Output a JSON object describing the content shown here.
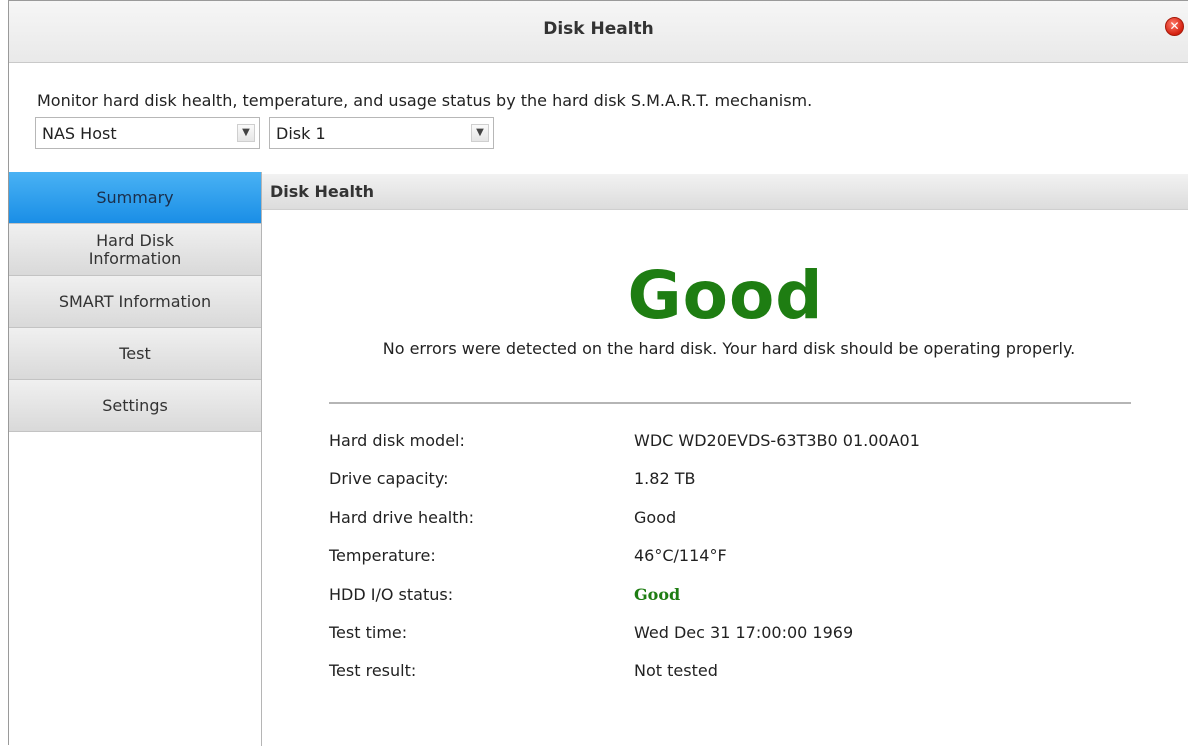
{
  "window": {
    "title": "Disk Health"
  },
  "description": "Monitor hard disk health, temperature, and usage status by the hard disk S.M.A.R.T. mechanism.",
  "selectors": {
    "host": "NAS Host",
    "disk": "Disk 1"
  },
  "sidebar": {
    "items": [
      {
        "label": "Summary",
        "active": true
      },
      {
        "label": "Hard Disk\nInformation",
        "active": false
      },
      {
        "label": "SMART Information",
        "active": false
      },
      {
        "label": "Test",
        "active": false
      },
      {
        "label": "Settings",
        "active": false
      }
    ]
  },
  "content": {
    "header": "Disk Health",
    "status": "Good",
    "message": "No errors were detected on the hard disk. Your hard disk should be operating properly.",
    "details": [
      {
        "label": "Hard disk model:",
        "value": "WDC WD20EVDS-63T3B0 01.00A01"
      },
      {
        "label": "Drive capacity:",
        "value": "1.82 TB"
      },
      {
        "label": "Hard drive health:",
        "value": "Good"
      },
      {
        "label": "Temperature:",
        "value": "46°C/114°F"
      },
      {
        "label": "HDD I/O status:",
        "value": "Good"
      },
      {
        "label": "Test time:",
        "value": "Wed Dec 31 17:00:00 1969"
      },
      {
        "label": "Test result:",
        "value": "Not tested"
      }
    ]
  },
  "colors": {
    "good": "#1e7d12",
    "active_tab": "#1a8ee6"
  },
  "icons": {
    "close": "close-icon",
    "dropdown": "chevron-down-icon"
  }
}
